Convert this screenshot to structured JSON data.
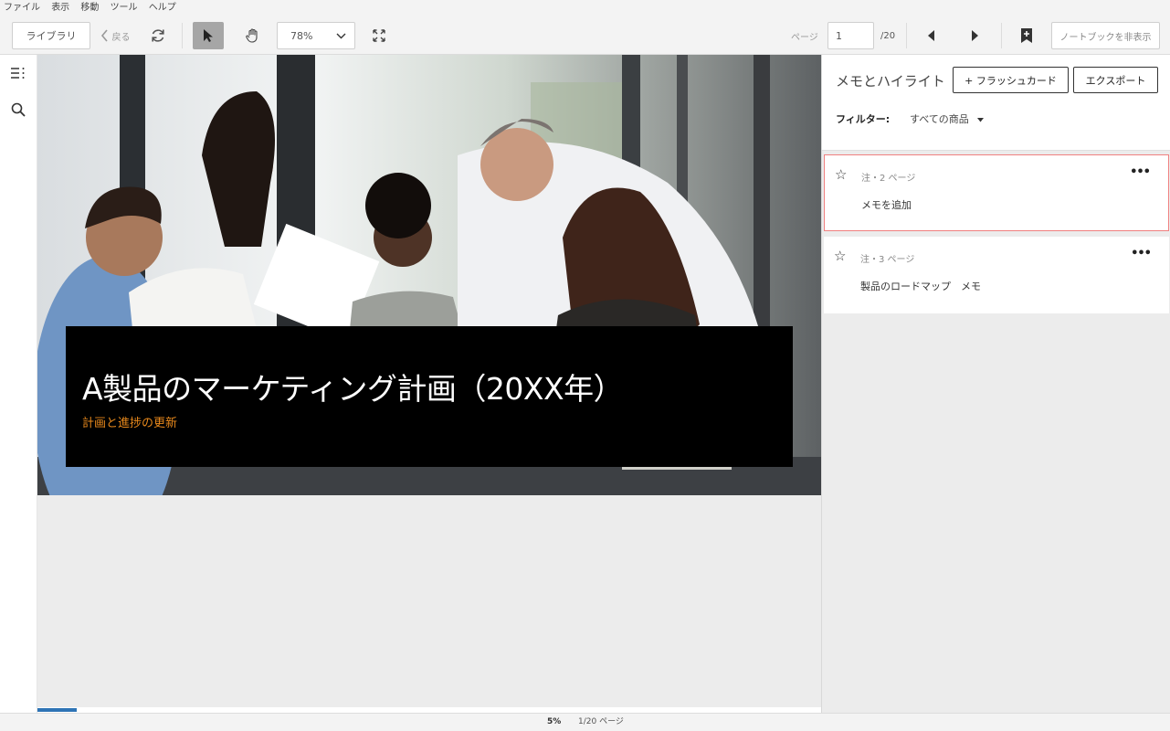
{
  "menu": [
    "ファイル",
    "表示",
    "移動",
    "ツール",
    "ヘルプ"
  ],
  "toolbar": {
    "library_label": "ライブラリ",
    "back_label": "戻る",
    "zoom_value": "78%",
    "page_label": "ページ",
    "page_value": "1",
    "page_total": "/20",
    "notebook_label": "ノートブックを非表示"
  },
  "slide": {
    "title": "A製品のマーケティング計画（20XX年）",
    "subtitle": "計画と進捗の更新"
  },
  "panel": {
    "title": "メモとハイライト",
    "flashcard_label": "+ フラッシュカード",
    "export_label": "エクスポート",
    "filter_label": "フィルター:",
    "filter_value": "すべての商品",
    "notes": [
      {
        "meta": "注・2 ページ",
        "text": "メモを追加"
      },
      {
        "meta": "注・3 ページ",
        "text": "製品のロードマップ　メモ"
      }
    ]
  },
  "status": {
    "percent": "5%",
    "page_info": "1/20 ページ",
    "progress": 0.05
  },
  "colors": {
    "accent": "#2e74b5",
    "subtitle": "#e8891c",
    "selected_border": "#f08080"
  }
}
